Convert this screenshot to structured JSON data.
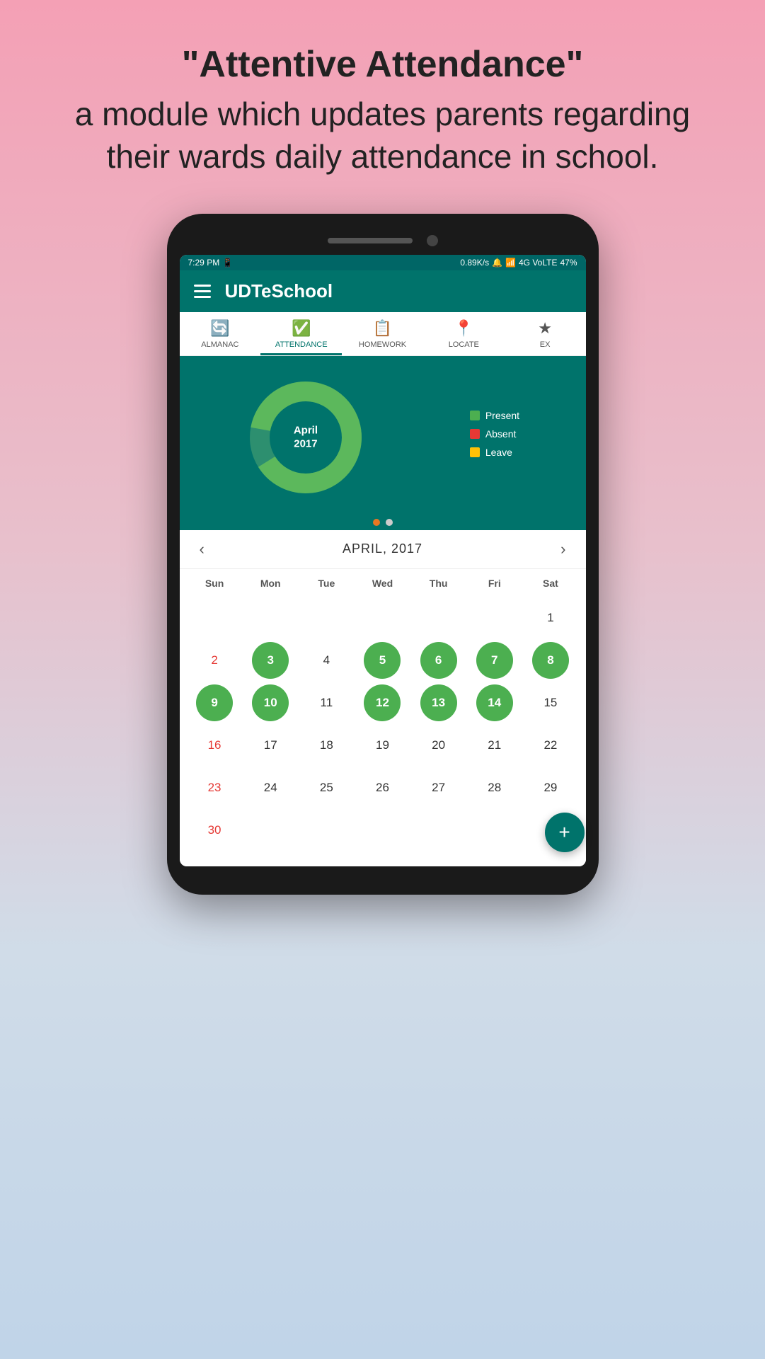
{
  "page": {
    "headline": "\"Attentive Attendance\"",
    "subheadline": "a module which updates parents regarding their wards daily attendance in school."
  },
  "status_bar": {
    "time": "7:29 PM",
    "network": "0.89K/s",
    "signal": "4G VoLTE",
    "battery": "47%"
  },
  "app": {
    "title": "UDTeSchool",
    "hamburger_label": "Menu"
  },
  "tabs": [
    {
      "id": "almanac",
      "label": "ALMANAC",
      "icon": "🔄",
      "active": false
    },
    {
      "id": "attendance",
      "label": "ATTENDANCE",
      "icon": "✅",
      "active": true
    },
    {
      "id": "homework",
      "label": "HOMEWORK",
      "icon": "📋",
      "active": false
    },
    {
      "id": "locate",
      "label": "LOCATE",
      "icon": "📍",
      "active": false
    },
    {
      "id": "extra",
      "label": "EX",
      "icon": "★",
      "active": false
    }
  ],
  "chart": {
    "month": "April",
    "year": "2017",
    "center_text": "April\n2017",
    "legend": [
      {
        "color": "#4caf50",
        "label": "Present"
      },
      {
        "color": "#e53935",
        "label": "Absent"
      },
      {
        "color": "#ffc107",
        "label": "Leave"
      }
    ],
    "dots": [
      {
        "active": true
      },
      {
        "active": false
      }
    ]
  },
  "calendar": {
    "title": "APRIL, 2017",
    "prev_label": "‹",
    "next_label": "›",
    "day_headers": [
      "Sun",
      "Mon",
      "Tue",
      "Wed",
      "Thu",
      "Fri",
      "Sat"
    ],
    "weeks": [
      [
        {
          "day": "",
          "type": "empty"
        },
        {
          "day": "",
          "type": "empty"
        },
        {
          "day": "",
          "type": "empty"
        },
        {
          "day": "",
          "type": "empty"
        },
        {
          "day": "",
          "type": "empty"
        },
        {
          "day": "",
          "type": "empty"
        },
        {
          "day": "1",
          "type": "normal"
        }
      ],
      [
        {
          "day": "2",
          "type": "sunday"
        },
        {
          "day": "3",
          "type": "present"
        },
        {
          "day": "4",
          "type": "normal"
        },
        {
          "day": "5",
          "type": "present"
        },
        {
          "day": "6",
          "type": "present"
        },
        {
          "day": "7",
          "type": "present"
        },
        {
          "day": "8",
          "type": "present"
        }
      ],
      [
        {
          "day": "9",
          "type": "present"
        },
        {
          "day": "10",
          "type": "present"
        },
        {
          "day": "11",
          "type": "normal"
        },
        {
          "day": "12",
          "type": "present"
        },
        {
          "day": "13",
          "type": "present"
        },
        {
          "day": "14",
          "type": "present"
        },
        {
          "day": "15",
          "type": "normal"
        }
      ],
      [
        {
          "day": "16",
          "type": "sunday"
        },
        {
          "day": "17",
          "type": "normal"
        },
        {
          "day": "18",
          "type": "normal"
        },
        {
          "day": "19",
          "type": "normal"
        },
        {
          "day": "20",
          "type": "normal"
        },
        {
          "day": "21",
          "type": "normal"
        },
        {
          "day": "22",
          "type": "normal"
        }
      ],
      [
        {
          "day": "23",
          "type": "sunday"
        },
        {
          "day": "24",
          "type": "normal"
        },
        {
          "day": "25",
          "type": "normal"
        },
        {
          "day": "26",
          "type": "normal"
        },
        {
          "day": "27",
          "type": "normal"
        },
        {
          "day": "28",
          "type": "normal"
        },
        {
          "day": "29",
          "type": "normal"
        }
      ],
      [
        {
          "day": "30",
          "type": "sunday"
        },
        {
          "day": "",
          "type": "empty"
        },
        {
          "day": "",
          "type": "empty"
        },
        {
          "day": "",
          "type": "empty"
        },
        {
          "day": "",
          "type": "empty"
        },
        {
          "day": "",
          "type": "empty"
        },
        {
          "day": "",
          "type": "empty"
        }
      ]
    ]
  },
  "fab": {
    "label": "+"
  }
}
